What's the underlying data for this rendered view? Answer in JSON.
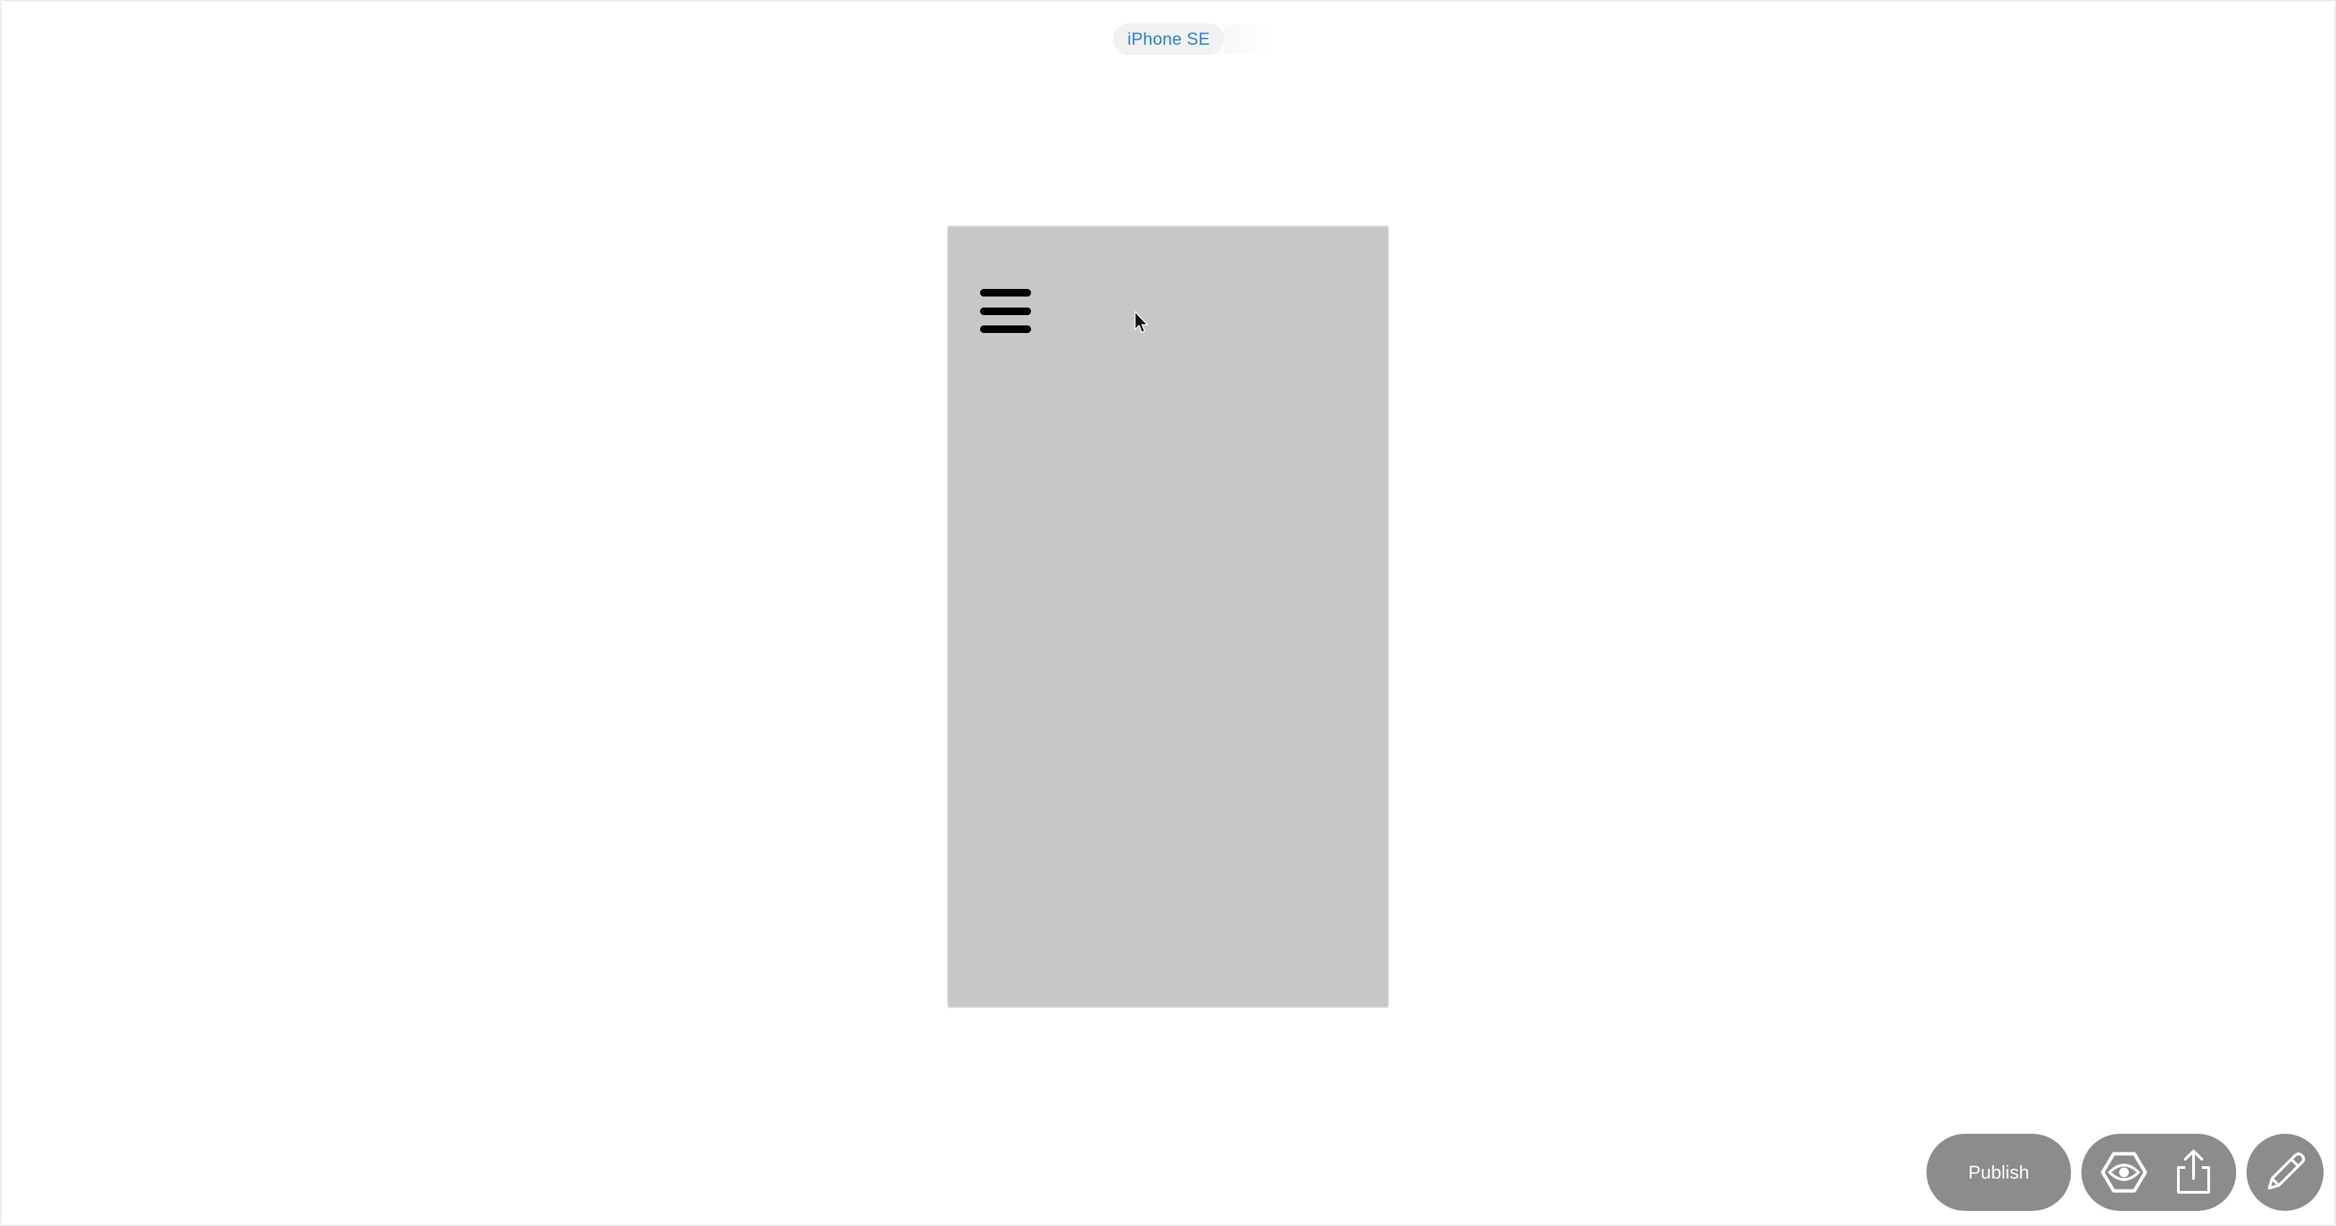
{
  "device_selector": {
    "label": "iPhone SE",
    "accent_color": "#2f7fd0"
  },
  "preview": {
    "background_color": "#c7c7c7",
    "menu_icon": "hamburger-menu-icon"
  },
  "toolbar": {
    "publish_label": "Publish",
    "preview_icon": "eye-hexagon-icon",
    "share_icon": "share-upload-icon",
    "edit_icon": "pencil-icon",
    "button_color": "#8c8c8c"
  }
}
